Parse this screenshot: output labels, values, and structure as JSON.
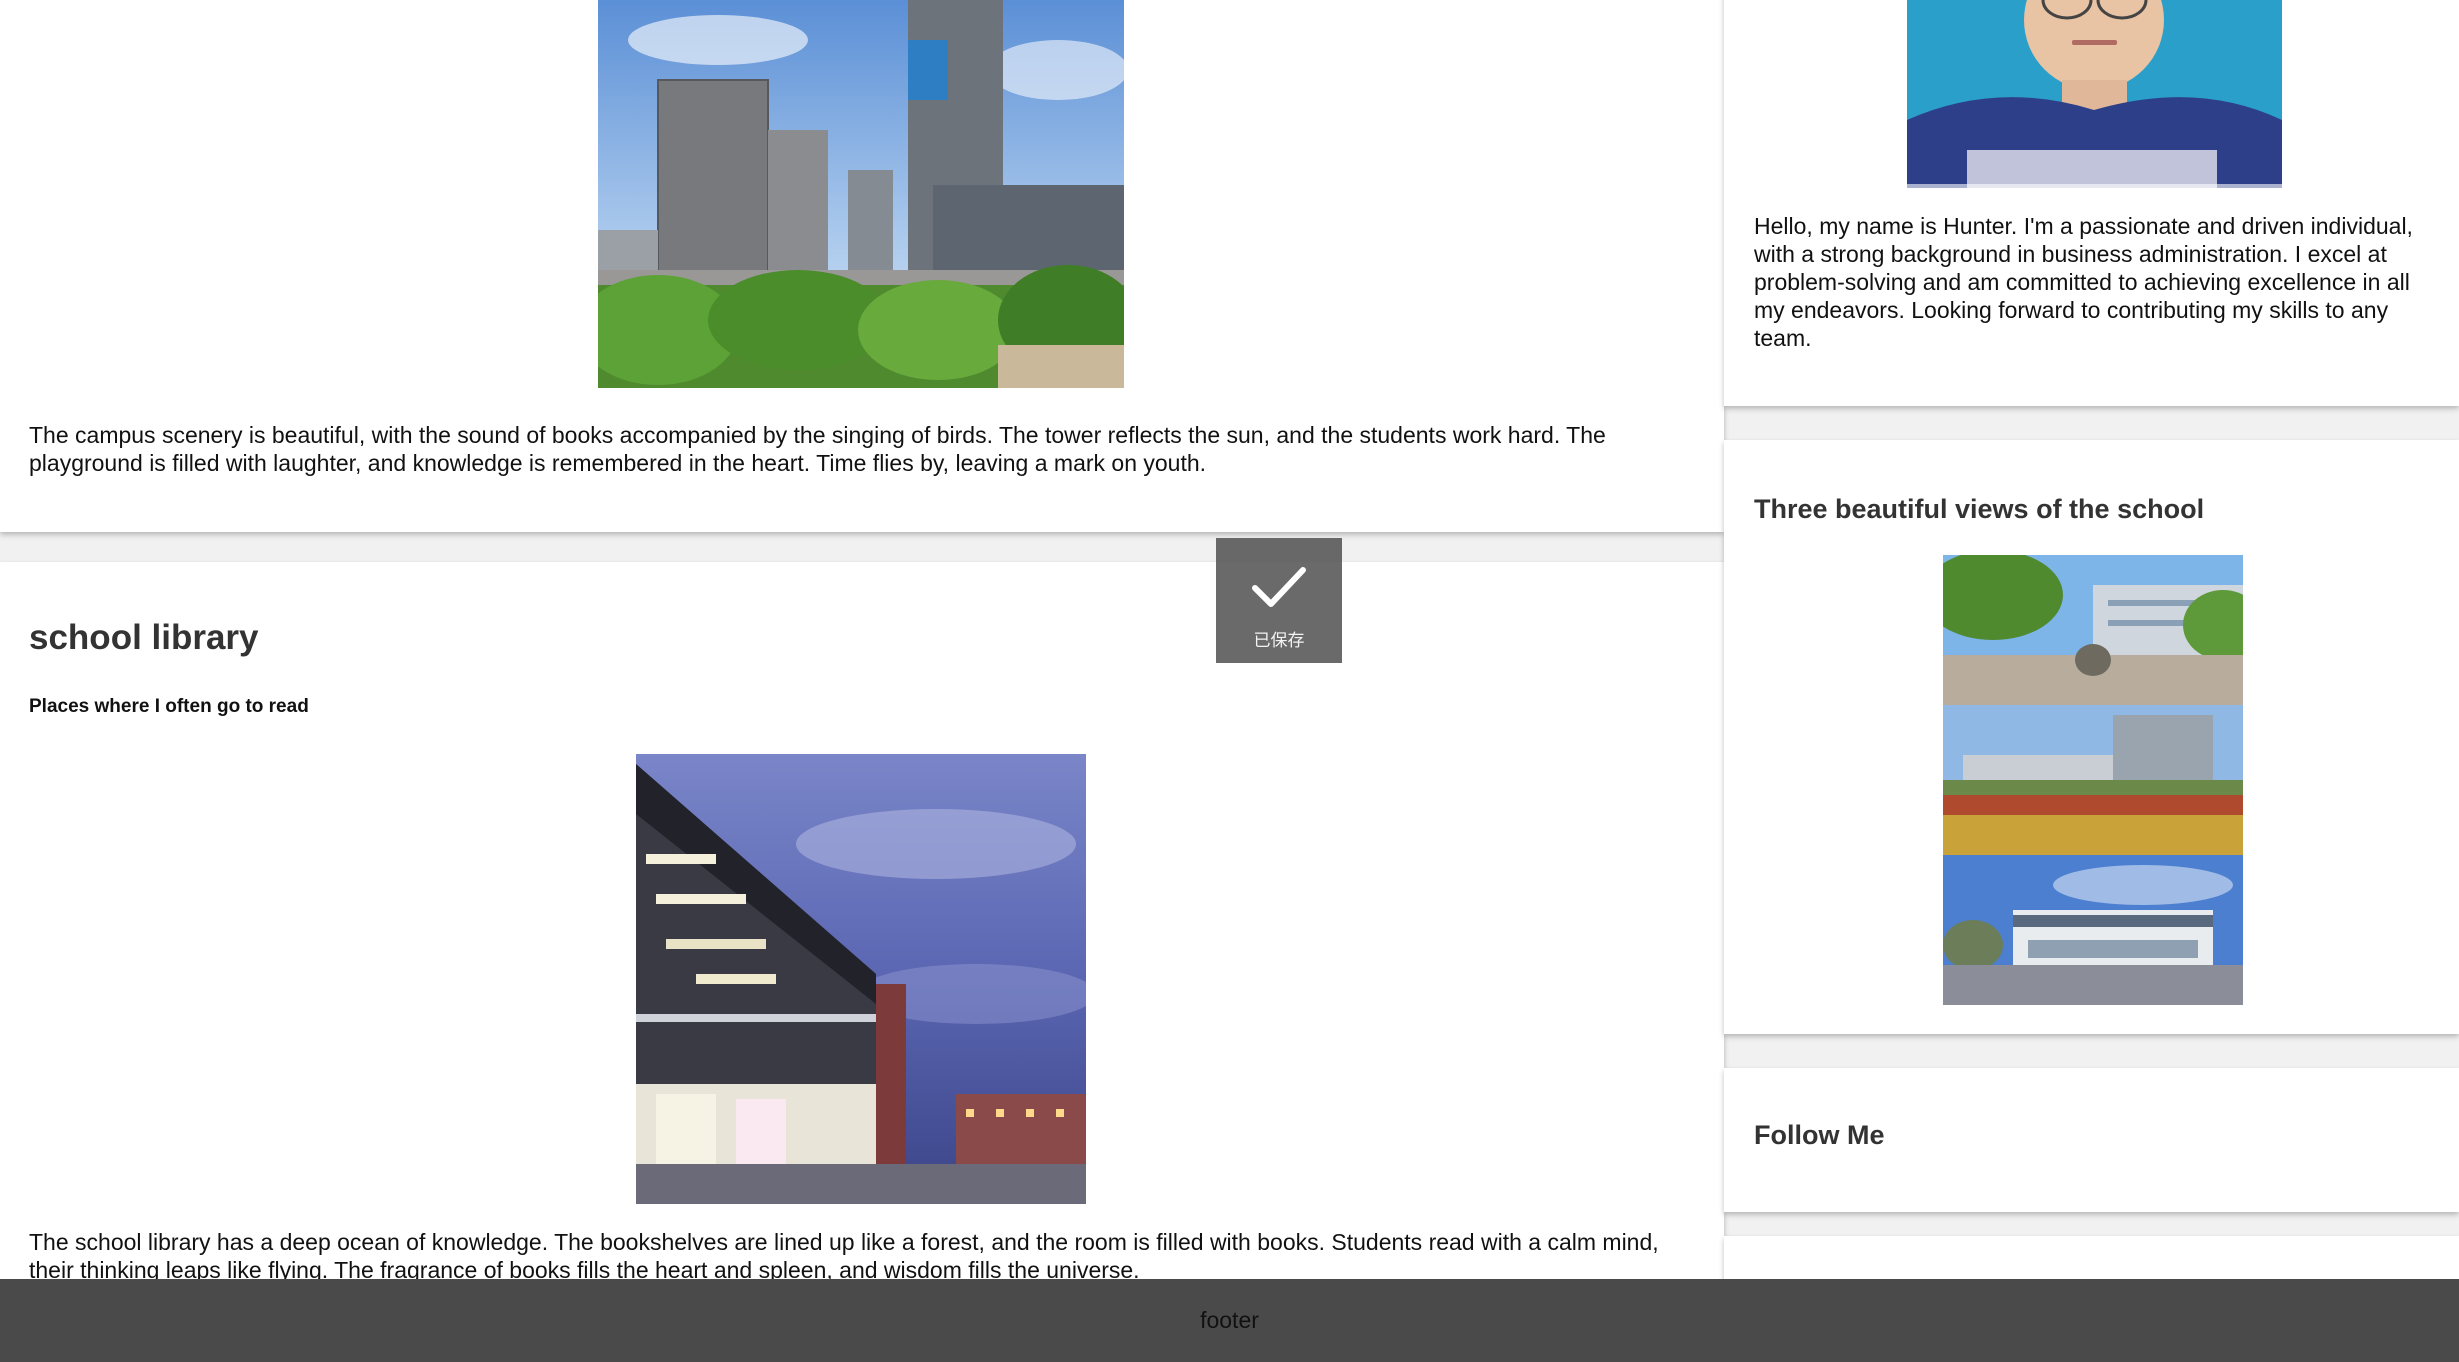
{
  "main": {
    "campus_section": {
      "text": "The campus scenery is beautiful, with the sound of books accompanied by the singing of birds. The tower reflects the sun, and the students work hard. The playground is filled with laughter, and knowledge is remembered in the heart. Time flies by, leaving a mark on youth."
    },
    "library_section": {
      "title": "school library",
      "subtitle": "Places where I often go to read",
      "text": "The school library has a deep ocean of knowledge. The bookshelves are lined up like a forest, and the room is filled with books. Students read with a calm mind, their thinking leaps like flying. The fragrance of books fills the heart and spleen, and wisdom fills the universe."
    }
  },
  "sidebar": {
    "about": {
      "text": "Hello, my name is Hunter. I'm a passionate and driven individual, with a strong background in business administration. I excel at problem-solving and am committed to achieving excellence in all my endeavors. Looking forward to contributing my skills to any team."
    },
    "views": {
      "heading": "Three beautiful views of the school"
    },
    "follow": {
      "heading": "Follow Me"
    }
  },
  "toast": {
    "label": "已保存",
    "icon": "checkmark-icon"
  },
  "footer": {
    "text": "footer"
  }
}
